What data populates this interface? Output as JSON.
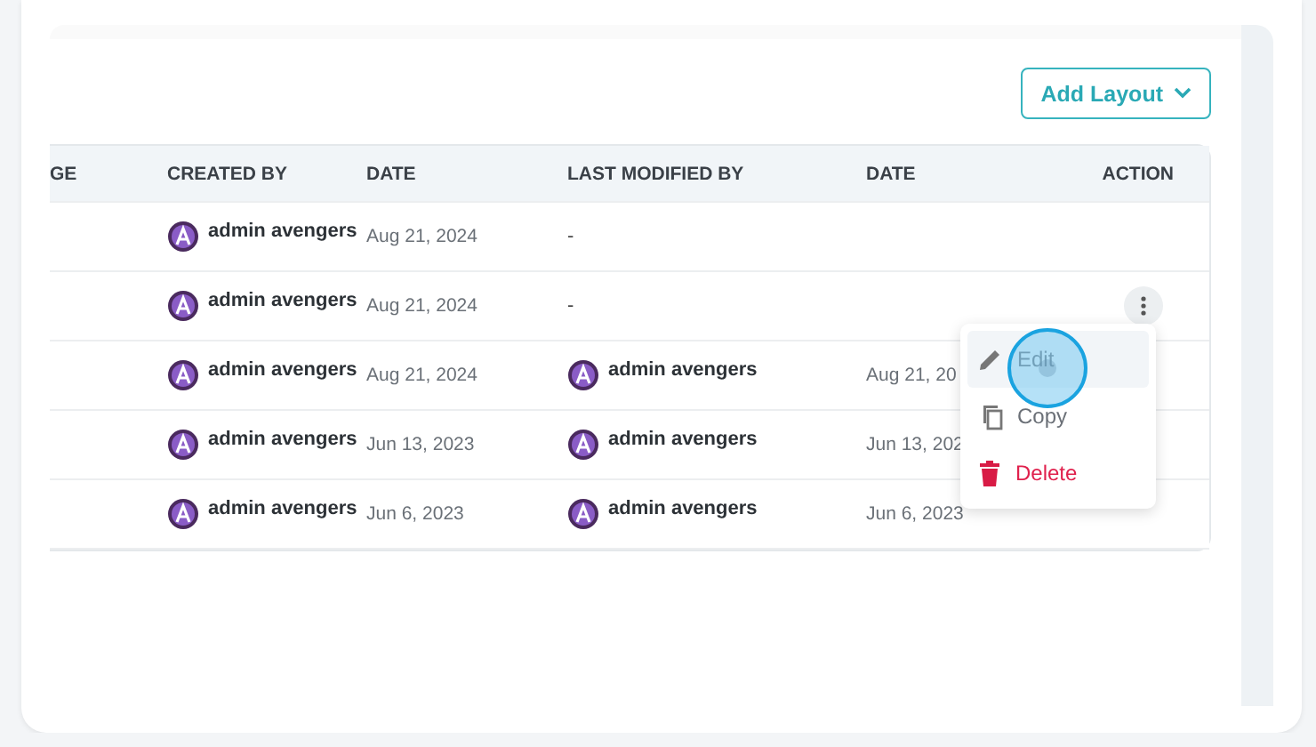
{
  "add_button": {
    "label": "Add Layout"
  },
  "table": {
    "columns": [
      "GE",
      "CREATED BY",
      "DATE",
      "LAST MODIFIED BY",
      "DATE",
      "ACTION"
    ],
    "rows": [
      {
        "created_by": "admin avengers",
        "date": "Aug 21, 2024",
        "last_modified_by": "-",
        "modified_date": "",
        "action_button": false
      },
      {
        "created_by": "admin avengers",
        "date": "Aug 21, 2024",
        "last_modified_by": "-",
        "modified_date": "",
        "action_button": true
      },
      {
        "created_by": "admin avengers",
        "date": "Aug 21, 2024",
        "last_modified_by": "admin avengers",
        "modified_date": "Aug 21, 20",
        "action_button": false
      },
      {
        "created_by": "admin avengers",
        "date": "Jun 13, 2023",
        "last_modified_by": "admin avengers",
        "modified_date": "Jun 13, 202",
        "action_button": false
      },
      {
        "created_by": "admin avengers",
        "date": "Jun 6, 2023",
        "last_modified_by": "admin avengers",
        "modified_date": "Jun 6, 2023",
        "action_button": false
      }
    ]
  },
  "menu": {
    "items": [
      {
        "kind": "edit",
        "label": "Edit",
        "selected": true
      },
      {
        "kind": "copy",
        "label": "Copy",
        "selected": false
      },
      {
        "kind": "delete",
        "label": "Delete",
        "selected": false
      }
    ]
  }
}
